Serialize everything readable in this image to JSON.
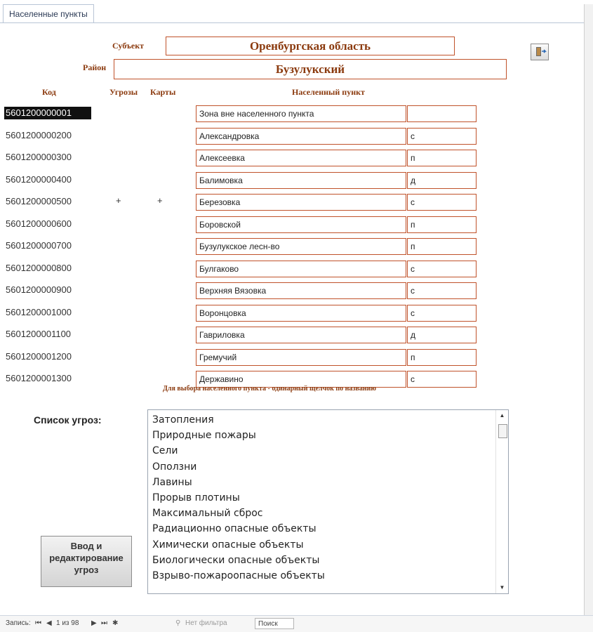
{
  "tab": {
    "title": "Населенные пункты"
  },
  "subject": {
    "label": "Субъект",
    "value": "Оренбургская область"
  },
  "district": {
    "label": "Район",
    "value": "Бузулукский"
  },
  "headers": {
    "code": "Код",
    "threats": "Угрозы",
    "maps": "Карты",
    "settlement": "Населенный пункт"
  },
  "rows": [
    {
      "code": "5601200000001",
      "threat": "",
      "map": "",
      "name": "Зона вне населенного пункта",
      "type": ""
    },
    {
      "code": "5601200000200",
      "threat": "",
      "map": "",
      "name": "Александровка",
      "type": "с"
    },
    {
      "code": "5601200000300",
      "threat": "",
      "map": "",
      "name": "Алексеевка",
      "type": "п"
    },
    {
      "code": "5601200000400",
      "threat": "",
      "map": "",
      "name": "Балимовка",
      "type": "д"
    },
    {
      "code": "5601200000500",
      "threat": "+",
      "map": "+",
      "name": "Березовка",
      "type": "с"
    },
    {
      "code": "5601200000600",
      "threat": "",
      "map": "",
      "name": "Боровской",
      "type": "п"
    },
    {
      "code": "5601200000700",
      "threat": "",
      "map": "",
      "name": "Бузулукское лесн-во",
      "type": "п"
    },
    {
      "code": "5601200000800",
      "threat": "",
      "map": "",
      "name": "Булгаково",
      "type": "с"
    },
    {
      "code": "5601200000900",
      "threat": "",
      "map": "",
      "name": "Верхняя Вязовка",
      "type": "с"
    },
    {
      "code": "5601200001000",
      "threat": "",
      "map": "",
      "name": "Воронцовка",
      "type": "с"
    },
    {
      "code": "5601200001100",
      "threat": "",
      "map": "",
      "name": "Гавриловка",
      "type": "д"
    },
    {
      "code": "5601200001200",
      "threat": "",
      "map": "",
      "name": "Гремучий",
      "type": "п"
    },
    {
      "code": "5601200001300",
      "threat": "",
      "map": "",
      "name": "Державино",
      "type": "с"
    }
  ],
  "hint": "Для выбора населенного пункта - одинарный щелчок по названию",
  "threats_label": "Список угроз:",
  "threats": [
    "Затопления",
    "Природные пожары",
    "Сели",
    "Оползни",
    "Лавины",
    "Прорыв плотины",
    "Максимальный сброс",
    "Радиационно опасные объекты",
    "Химически опасные объекты",
    "Биологически опасные объекты",
    "Взрыво-пожароопасные объекты"
  ],
  "edit_button": {
    "line1": "Ввод и",
    "line2": "редактирование",
    "line3": "угроз"
  },
  "navbar": {
    "records_label": "Запись:",
    "position": "1 из 98",
    "filter": "Нет фильтра",
    "search": "Поиск"
  },
  "colors": {
    "accent": "#8b3a0e",
    "border": "#c0522a"
  },
  "icons": {
    "close": "exit-door-icon"
  }
}
